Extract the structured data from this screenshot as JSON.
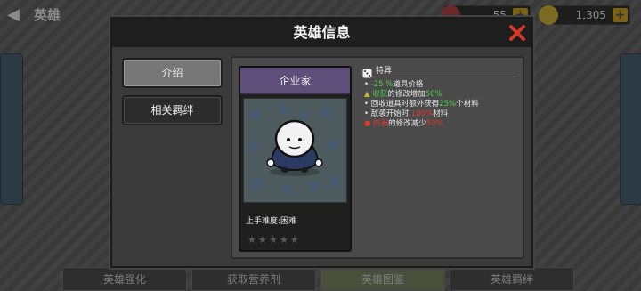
{
  "topbar": {
    "title": "英雄",
    "gems": "55",
    "coins": "1,305",
    "plus": "+"
  },
  "bottom_tabs": [
    "英雄强化",
    "获取营养剂",
    "英雄图鉴",
    "英雄羁绊"
  ],
  "modal": {
    "title": "英雄信息",
    "nav": {
      "intro": "介绍",
      "bonds": "相关羁绊"
    }
  },
  "hero": {
    "name": "企业家",
    "difficulty": "上手难度:困难",
    "stars_filled": 0,
    "stars_total": 5
  },
  "traits": {
    "title": "特异",
    "items": [
      {
        "prefix": "•",
        "highlight": "-25 %",
        "rest": "道具价格",
        "color": "#49d14a"
      },
      {
        "prefix": "",
        "highlight": "收获",
        "rest": "的修改增加",
        "value": "50%",
        "color": "#49d14a"
      },
      {
        "prefix": "•",
        "text_before": "回收道具时额外获得",
        "value": "25%",
        "rest": "个材料",
        "color": "#49d14a"
      },
      {
        "prefix": "•",
        "text_before": "敌袭开始时 ",
        "value": "100%",
        "rest": "材料",
        "color": "#e0392e"
      },
      {
        "prefix": "",
        "highlight": "伤害",
        "rest": "的修改减少",
        "value": "50%",
        "color": "#e0392e"
      }
    ]
  },
  "colors": {
    "accent_green": "#49d14a",
    "accent_red": "#e0392e",
    "hero_bar": "#5d4f7a",
    "close_red": "#d33a2c"
  }
}
